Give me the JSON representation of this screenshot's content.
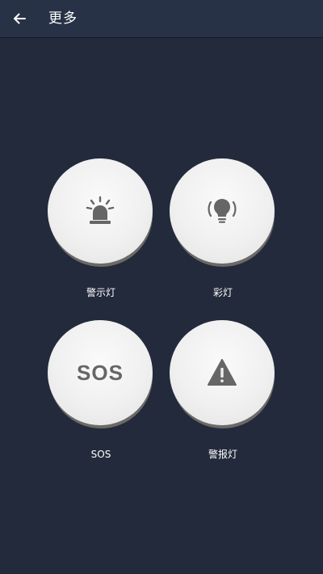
{
  "header": {
    "title": "更多",
    "back_icon": "arrow-left-icon"
  },
  "colors": {
    "background": "#232a3c",
    "header": "#283247",
    "button_face": "#f0f0f0",
    "icon": "#666666"
  },
  "buttons": [
    {
      "label": "警示灯",
      "icon": "siren-icon"
    },
    {
      "label": "彩灯",
      "icon": "lightbulb-icon"
    },
    {
      "label": "SOS",
      "icon_text": "SOS"
    },
    {
      "label": "警报灯",
      "icon": "warning-triangle-icon"
    }
  ]
}
